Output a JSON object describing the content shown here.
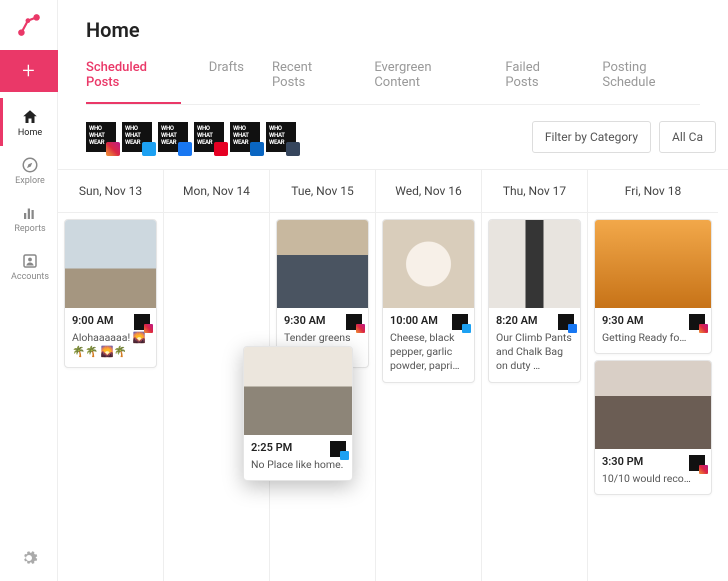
{
  "page_title": "Home",
  "sidebar": {
    "nav": [
      {
        "icon": "home",
        "label": "Home",
        "active": true
      },
      {
        "icon": "explore",
        "label": "Explore",
        "active": false
      },
      {
        "icon": "reports",
        "label": "Reports",
        "active": false
      },
      {
        "icon": "accounts",
        "label": "Accounts",
        "active": false
      }
    ]
  },
  "tabs": [
    {
      "label": "Scheduled Posts",
      "active": true
    },
    {
      "label": "Drafts"
    },
    {
      "label": "Recent Posts"
    },
    {
      "label": "Evergreen Content"
    },
    {
      "label": "Failed Posts"
    },
    {
      "label": "Posting Schedule"
    }
  ],
  "account_logo_text": "WHO WHAT WEAR",
  "filters": {
    "category_label": "Filter by Category",
    "all_label": "All Ca"
  },
  "networks": [
    "instagram",
    "twitter",
    "facebook",
    "pinterest",
    "linkedin",
    "tumblr"
  ],
  "days": [
    {
      "label": "Sun, Nov 13"
    },
    {
      "label": "Mon, Nov 14"
    },
    {
      "label": "Tue, Nov 15"
    },
    {
      "label": "Wed, Nov 16"
    },
    {
      "label": "Thu, Nov 17"
    },
    {
      "label": "Fri, Nov 18"
    }
  ],
  "posts": {
    "sun": {
      "time": "9:00 AM",
      "text": "Alohaaaaaa! 🌄🌴🌴 🌄🌴",
      "network": "instagram"
    },
    "tue": {
      "time": "9:30 AM",
      "text": "Tender greens cater…",
      "network": "instagram"
    },
    "wed": {
      "time": "10:00 AM",
      "text": "Cheese, black pepper, garlic powder, papri…",
      "network": "twitter"
    },
    "thu": {
      "time": "8:20 AM",
      "text": "Our Climb Pants and Chalk Bag on duty …",
      "network": "facebook"
    },
    "fri1": {
      "time": "9:30 AM",
      "text": "Getting Ready fo…",
      "network": "instagram"
    },
    "fri2": {
      "time": "3:30 PM",
      "text": "10/10 would reco…",
      "network": "instagram"
    },
    "float": {
      "time": "2:25 PM",
      "text": "No Place like home.",
      "network": "twitter"
    }
  }
}
